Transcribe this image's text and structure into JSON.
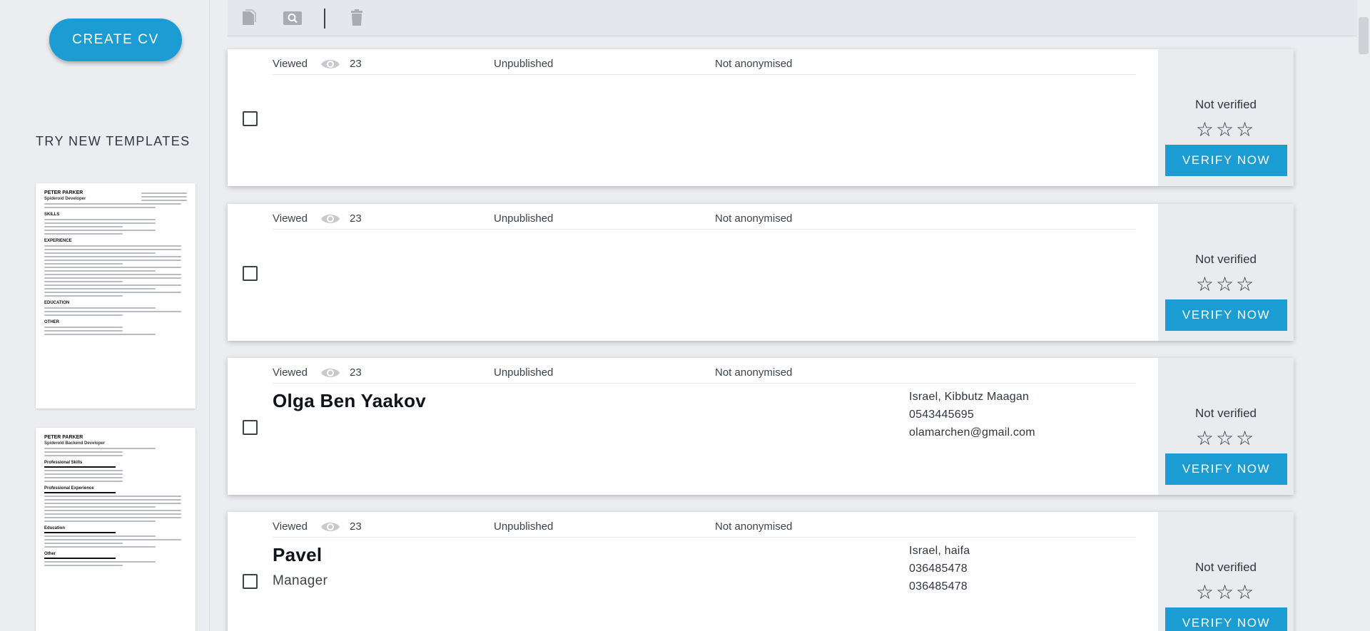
{
  "sidebar": {
    "create_label": "CREATE CV",
    "templates_heading": "TRY NEW TEMPLATES",
    "templates": [
      {
        "name": "PETER PARKER",
        "role": "Spideroid Developer",
        "sections": [
          "SKILLS",
          "EXPERIENCE",
          "EDUCATION",
          "OTHER"
        ]
      },
      {
        "name": "PETER PARKER",
        "role": "Spiderold Backend Developer",
        "sections": [
          "Professional Skills",
          "Professional Experience",
          "Education",
          "Other"
        ]
      }
    ]
  },
  "toolbar": {
    "icons": [
      "copy-icon",
      "preview-icon",
      "delete-icon"
    ]
  },
  "cards": [
    {
      "viewed_label": "Viewed",
      "views": "23",
      "publish_status": "Unpublished",
      "anon_status": "Not anonymised",
      "name": "",
      "title": "",
      "contact": [],
      "verify_status": "Not verified",
      "verify_label": "VERIFY NOW"
    },
    {
      "viewed_label": "Viewed",
      "views": "23",
      "publish_status": "Unpublished",
      "anon_status": "Not anonymised",
      "name": "",
      "title": "",
      "contact": [],
      "verify_status": "Not verified",
      "verify_label": "VERIFY NOW"
    },
    {
      "viewed_label": "Viewed",
      "views": "23",
      "publish_status": "Unpublished",
      "anon_status": "Not anonymised",
      "name": "Olga Ben Yaakov",
      "title": "",
      "contact": [
        "Israel, Kibbutz Maagan",
        "0543445695",
        "olamarchen@gmail.com"
      ],
      "verify_status": "Not verified",
      "verify_label": "VERIFY NOW"
    },
    {
      "viewed_label": "Viewed",
      "views": "23",
      "publish_status": "Unpublished",
      "anon_status": "Not anonymised",
      "name": "Pavel",
      "title": "Manager",
      "contact": [
        "Israel, haifa",
        "036485478",
        "036485478"
      ],
      "verify_status": "Not verified",
      "verify_label": "VERIFY NOW"
    }
  ],
  "colors": {
    "accent": "#1b9dd3",
    "background": "#ebedf0",
    "verify_panel": "#e9ebee"
  }
}
